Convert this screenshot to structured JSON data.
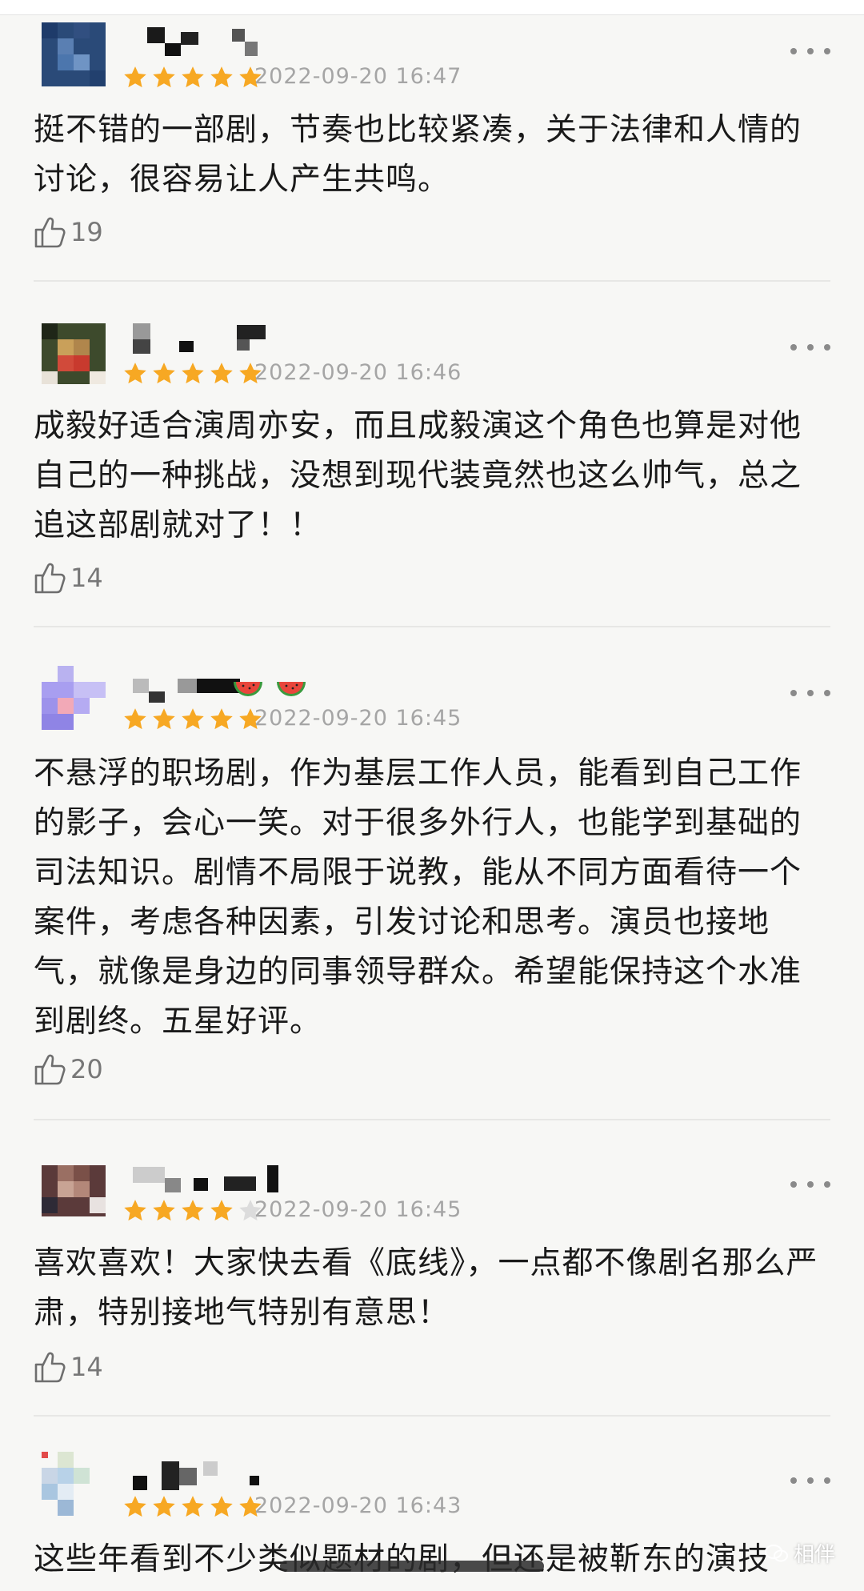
{
  "comments": [
    {
      "time": "2022-09-20 16:47",
      "rating": 5,
      "text": "挺不错的一部剧，节奏也比较紧凑，关于法律和人情的讨论，很容易让人产生共鸣。",
      "likes": "19"
    },
    {
      "time": "2022-09-20 16:46",
      "rating": 5,
      "text": "成毅好适合演周亦安，而且成毅演这个角色也算是对他自己的一种挑战，没想到现代装竟然也这么帅气，总之追这部剧就对了！！",
      "likes": "14"
    },
    {
      "time": "2022-09-20 16:45",
      "rating": 5,
      "text": "不悬浮的职场剧，作为基层工作人员，能看到自己工作的影子，会心一笑。对于很多外行人，也能学到基础的司法知识。剧情不局限于说教，能从不同方面看待一个案件，考虑各种因素，引发讨论和思考。演员也接地气，就像是身边的同事领导群众。希望能保持这个水准到剧终。五星好评。",
      "likes": "20"
    },
    {
      "time": "2022-09-20 16:45",
      "rating": 4,
      "text": "喜欢喜欢！大家快去看《底线》，一点都不像剧名那么严肃，特别接地气特别有意思！",
      "likes": "14"
    },
    {
      "time": "2022-09-20 16:43",
      "rating": 5,
      "text": "这些年看到不少类似题材的剧，但还是被靳东的演技",
      "likes": ""
    }
  ],
  "watermark": "相伴",
  "colors": {
    "star_on": "#f7a823",
    "star_off": "#dcdcdc",
    "time": "#a5a5a5",
    "background": "#f7f7f5"
  },
  "icons": {
    "like": "thumbs-up-icon",
    "more": "more-dots-icon",
    "star": "star-icon"
  }
}
